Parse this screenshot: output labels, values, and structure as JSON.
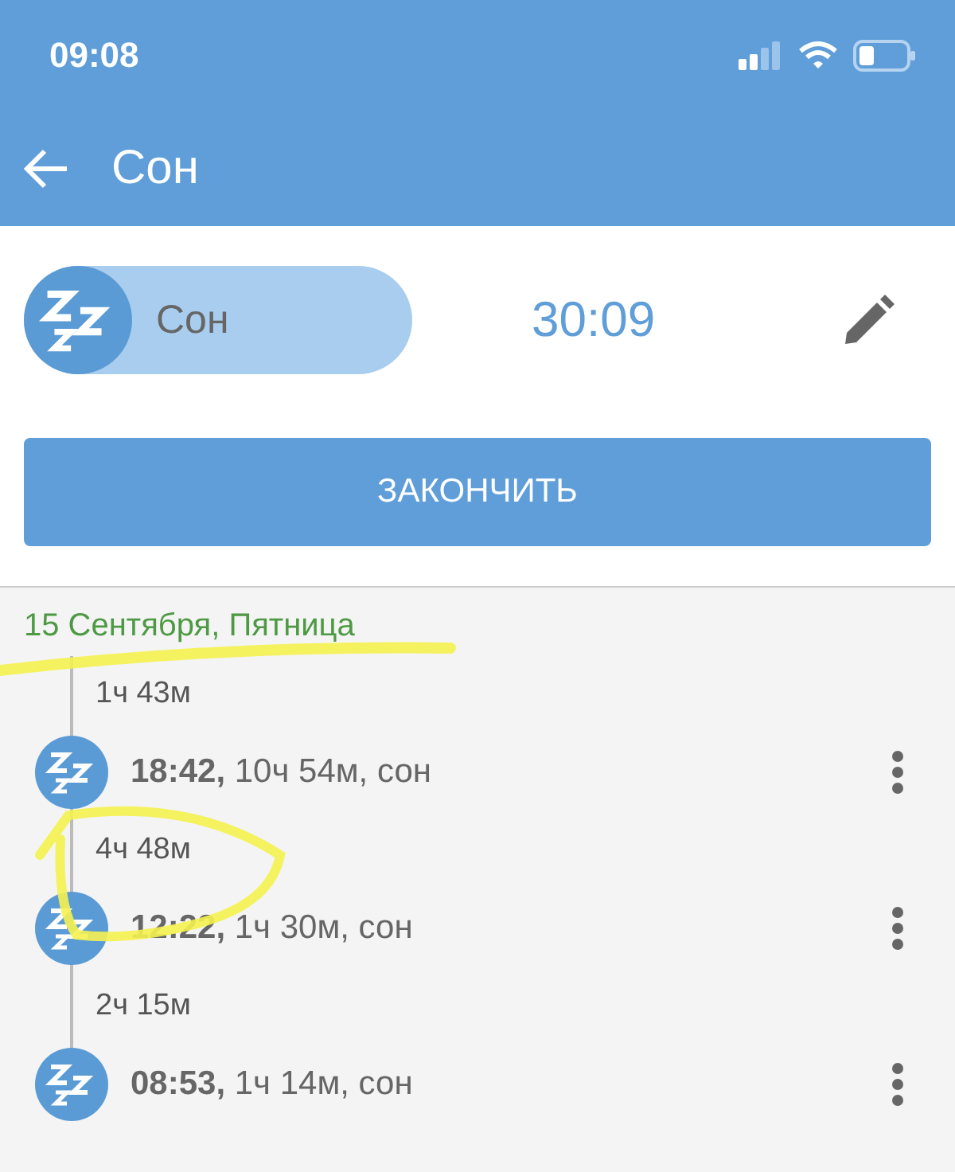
{
  "status_bar": {
    "time": "09:08"
  },
  "app_bar": {
    "title": "Сон"
  },
  "activity": {
    "label": "Сон",
    "on": true,
    "timer": "30:09"
  },
  "finish_button": "ЗАКОНЧИТЬ",
  "timeline": {
    "date": "15 Сентября, Пятница",
    "entries": [
      {
        "gap": "1ч 43м",
        "text": "**18:42,** 10ч 54м, сон"
      },
      {
        "gap": "4ч 48м",
        "text": "**12:22,** 1ч 30м, сон"
      },
      {
        "gap": "2ч 15м",
        "text": "**08:53,** 1ч 14м, сон"
      }
    ]
  }
}
